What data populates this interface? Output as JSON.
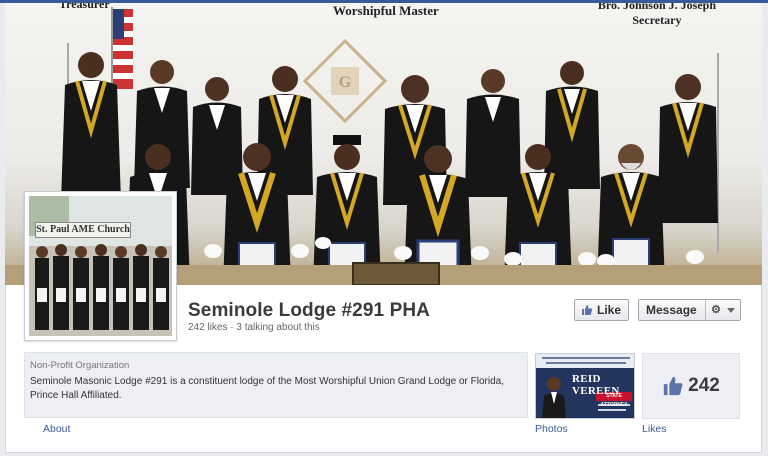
{
  "cover": {
    "treasurer_text": "Treasurer",
    "master_text": "Worshipful Master",
    "secretary_name": "Bro. Johnson J. Joseph",
    "secretary_title": "Secretary"
  },
  "profile": {
    "sign_text": "St. Paul AME Church"
  },
  "page": {
    "name": "Seminole Lodge #291 PHA",
    "stats": "242 likes · 3 talking about this"
  },
  "actions": {
    "like_label": "Like",
    "message_label": "Message",
    "gear_icon": "gear-icon"
  },
  "about": {
    "category": "Non-Profit Organization",
    "description": "Seminole Masonic Lodge #291 is a constituent lodge of the Most Worshipful Union Grand Lodge or Florida, Prince Hall Affiliated."
  },
  "photos_thumb": {
    "title": "REID VEREEN",
    "subtitle": "STATE ATTORNEY"
  },
  "likes": {
    "count": "242"
  },
  "tabs": {
    "about": "About",
    "photos": "Photos",
    "likes": "Likes"
  },
  "colors": {
    "facebook_blue": "#3b5998",
    "tuxedo": "#161616",
    "collar_gold": "#d4a825"
  }
}
